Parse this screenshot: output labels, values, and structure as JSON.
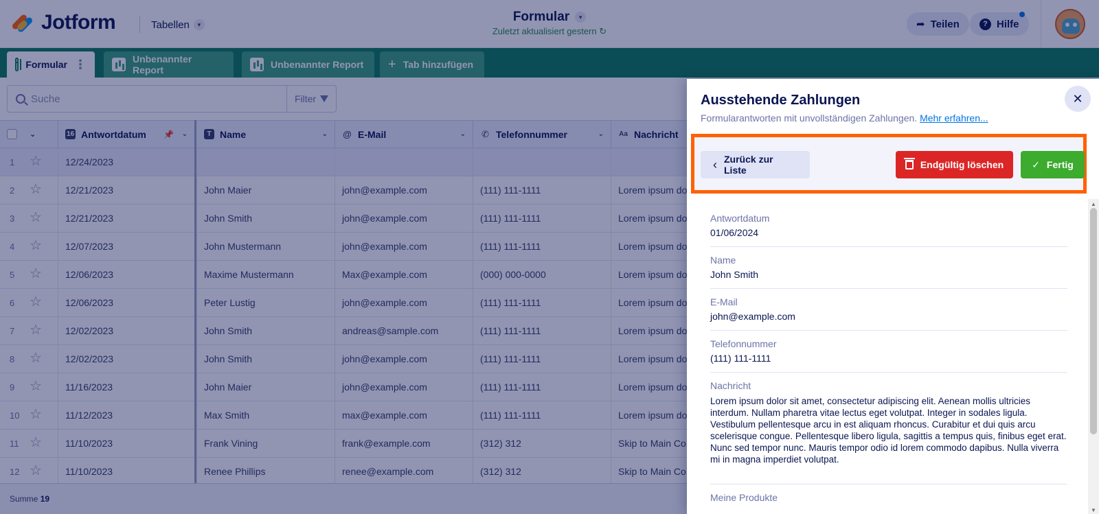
{
  "header": {
    "logo_text": "Jotform",
    "tables_menu": "Tabellen",
    "form_title": "Formular",
    "last_updated": "Zuletzt aktualisiert gestern",
    "share_label": "Teilen",
    "help_label": "Hilfe"
  },
  "tabs": [
    {
      "label": "Formular",
      "icon": "grid-icon",
      "active": true
    },
    {
      "label": "Unbenannter Report",
      "icon": "report-icon",
      "active": false
    },
    {
      "label": "Unbenannter Report",
      "icon": "report-icon",
      "active": false
    },
    {
      "label": "Tab hinzufügen",
      "icon": "plus-icon",
      "active": false
    }
  ],
  "toolbar": {
    "search_placeholder": "Suche",
    "filter_label": "Filter"
  },
  "table": {
    "columns": [
      "Antwortdatum",
      "Name",
      "E-Mail",
      "Telefonnummer",
      "Nachricht"
    ],
    "rows": [
      {
        "num": "1",
        "date": "12/24/2023",
        "name": "",
        "email": "",
        "phone": "",
        "message": ""
      },
      {
        "num": "2",
        "date": "12/21/2023",
        "name": "John Maier",
        "email": "john@example.com",
        "phone": "(111) 111-1111",
        "message": "Lorem ipsum do"
      },
      {
        "num": "3",
        "date": "12/21/2023",
        "name": "John Smith",
        "email": "john@example.com",
        "phone": "(111) 111-1111",
        "message": "Lorem ipsum do"
      },
      {
        "num": "4",
        "date": "12/07/2023",
        "name": "John Mustermann",
        "email": "john@example.com",
        "phone": "(111) 111-1111",
        "message": "Lorem ipsum do"
      },
      {
        "num": "5",
        "date": "12/06/2023",
        "name": "Maxime Mustermann",
        "email": "Max@example.com",
        "phone": "(000) 000-0000",
        "message": "Lorem ipsum do"
      },
      {
        "num": "6",
        "date": "12/06/2023",
        "name": "Peter Lustig",
        "email": "john@example.com",
        "phone": "(111) 111-1111",
        "message": "Lorem ipsum do"
      },
      {
        "num": "7",
        "date": "12/02/2023",
        "name": "John Smith",
        "email": "andreas@sample.com",
        "phone": "(111) 111-1111",
        "message": "Lorem ipsum do"
      },
      {
        "num": "8",
        "date": "12/02/2023",
        "name": "John Smith",
        "email": "john@example.com",
        "phone": "(111) 111-1111",
        "message": "Lorem ipsum do"
      },
      {
        "num": "9",
        "date": "11/16/2023",
        "name": "John Maier",
        "email": "john@example.com",
        "phone": "(111) 111-1111",
        "message": "Lorem ipsum do"
      },
      {
        "num": "10",
        "date": "11/12/2023",
        "name": "Max Smith",
        "email": "max@example.com",
        "phone": "(111) 111-1111",
        "message": "Lorem ipsum do"
      },
      {
        "num": "11",
        "date": "11/10/2023",
        "name": "Frank Vining",
        "email": "frank@example.com",
        "phone": "(312) 312",
        "message": "Skip to Main Co"
      },
      {
        "num": "12",
        "date": "11/10/2023",
        "name": "Renee Phillips",
        "email": "renee@example.com",
        "phone": "(312) 312",
        "message": "Skip to Main Co"
      }
    ],
    "footer_sum_label": "Summe",
    "footer_sum_value": "19"
  },
  "panel": {
    "title": "Ausstehende Zahlungen",
    "description": "Formularantworten mit unvollständigen Zahlungen.",
    "learn_more": "Mehr erfahren...",
    "back_label": "Zurück zur Liste",
    "delete_label": "Endgültig löschen",
    "done_label": "Fertig",
    "fields": [
      {
        "label": "Antwortdatum",
        "value": "01/06/2024"
      },
      {
        "label": "Name",
        "value": "John Smith"
      },
      {
        "label": "E-Mail",
        "value": "john@example.com"
      },
      {
        "label": "Telefonnummer",
        "value": "(111) 111-1111"
      },
      {
        "label": "Nachricht",
        "value": "Lorem ipsum dolor sit amet, consectetur adipiscing elit. Aenean mollis ultricies interdum. Nullam pharetra vitae lectus eget volutpat. Integer in sodales ligula. Vestibulum pellentesque arcu in est aliquam rhoncus. Curabitur et dui quis arcu scelerisque congue. Pellentesque libero ligula, sagittis a tempus quis, finibus eget erat. Nunc sed tempor nunc. Mauris tempor odio id lorem commodo dapibus. Nulla viverra mi in magna imperdiet volutpat."
      },
      {
        "label": "Meine Produkte",
        "value": ""
      }
    ]
  },
  "colors": {
    "brand_green": "#0c7c59",
    "highlight_orange": "#ff6100",
    "delete_red": "#dc2626",
    "done_green": "#3cab2e"
  }
}
